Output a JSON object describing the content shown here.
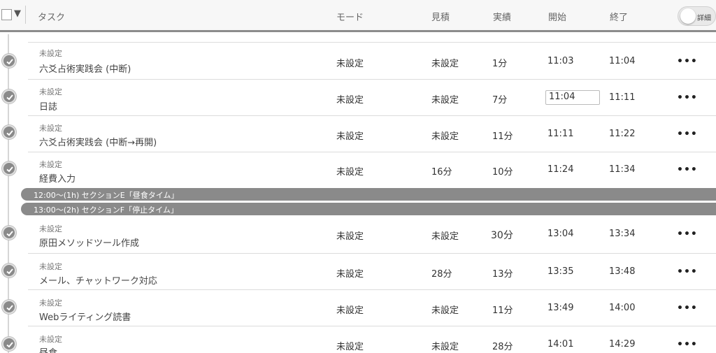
{
  "header": {
    "columns": {
      "task": "タスク",
      "mode": "モード",
      "estimate": "見積",
      "actual": "実績",
      "start": "開始",
      "end": "終了"
    },
    "detail_toggle_label": "詳細"
  },
  "tasks": [
    {
      "mode_small": "未設定",
      "name": "六爻占術実践会 (中断)",
      "mode": "未設定",
      "estimate": "未設定",
      "actual": "1分",
      "start": "11:03",
      "end": "11:04",
      "more": "•••"
    },
    {
      "mode_small": "未設定",
      "name": "日誌",
      "mode": "未設定",
      "estimate": "未設定",
      "actual": "7分",
      "start": "11:04",
      "end": "11:11",
      "more": "•••"
    },
    {
      "mode_small": "未設定",
      "name": "六爻占術実践会 (中断→再開)",
      "mode": "未設定",
      "estimate": "未設定",
      "actual": "11分",
      "start": "11:11",
      "end": "11:22",
      "more": "•••"
    },
    {
      "mode_small": "未設定",
      "name": "経費入力",
      "mode": "未設定",
      "estimate": "16分",
      "actual": "10分",
      "start": "11:24",
      "end": "11:34",
      "more": "•••"
    },
    {
      "mode_small": "未設定",
      "name": "原田メソッドツール作成",
      "mode": "未設定",
      "estimate": "未設定",
      "actual": "30分",
      "start": "13:04",
      "end": "13:34",
      "more": "•••"
    },
    {
      "mode_small": "未設定",
      "name": "メール、チャットワーク対応",
      "mode": "未設定",
      "estimate": "28分",
      "actual": "13分",
      "start": "13:35",
      "end": "13:48",
      "more": "•••"
    },
    {
      "mode_small": "未設定",
      "name": "Webライティング読書",
      "mode": "未設定",
      "estimate": "未設定",
      "actual": "11分",
      "start": "13:49",
      "end": "14:00",
      "more": "•••"
    },
    {
      "mode_small": "未設定",
      "name": "昼食",
      "mode": "未設定",
      "estimate": "未設定",
      "actual": "28分",
      "start": "14:01",
      "end": "14:29",
      "more": "•••"
    }
  ],
  "sections": [
    {
      "label": "12:00〜(1h) セクションE「昼食タイム」"
    },
    {
      "label": "13:00〜(2h) セクションF「停止タイム」"
    }
  ]
}
